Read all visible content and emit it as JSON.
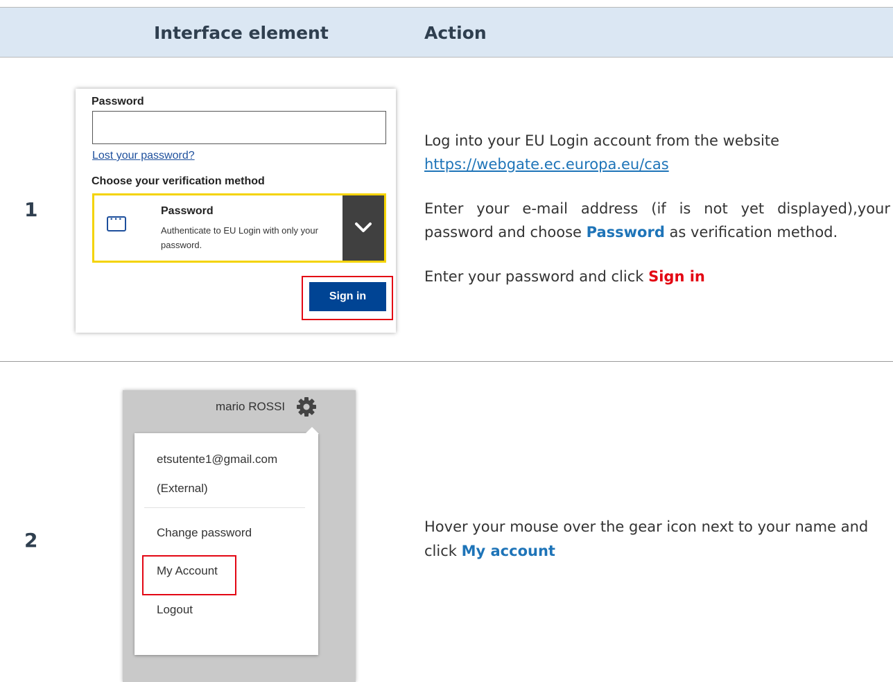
{
  "header": {
    "col1": "Interface element",
    "col2": "Action"
  },
  "step1": {
    "number": "1",
    "screenshot": {
      "password_label": "Password",
      "password_value": "",
      "lost_link": "Lost your password?",
      "choose_label": "Choose your verification method",
      "method_title": "Password",
      "method_desc": "Authenticate to EU Login with only your password.",
      "method_icon": "dots-icon",
      "sign_in_label": "Sign in"
    },
    "action": {
      "line1": "Log into your EU Login account from the website",
      "url": "https://webgate.ec.europa.eu/cas",
      "line2_pre": "Enter your e-mail address (if is not yet displayed),your password and choose ",
      "line2_bold": "Password",
      "line2_post": " as verification method.",
      "line3_pre": "Enter your password and click ",
      "line3_bold": "Sign in"
    }
  },
  "step2": {
    "number": "2",
    "screenshot": {
      "user_name": "mario ROSSI",
      "email": "etsutente1@gmail.com",
      "user_type": "(External)",
      "change_password": "Change password",
      "my_account": "My Account",
      "logout": "Logout"
    },
    "action": {
      "text_pre": "Hover your mouse over the gear icon next to your name and click ",
      "text_bold": "My account"
    }
  },
  "colors": {
    "header_bg": "#dbe7f3",
    "brand_blue": "#004494",
    "highlight_red": "#e30613",
    "method_border": "#f4d300",
    "text_blue": "#1e74b8"
  }
}
